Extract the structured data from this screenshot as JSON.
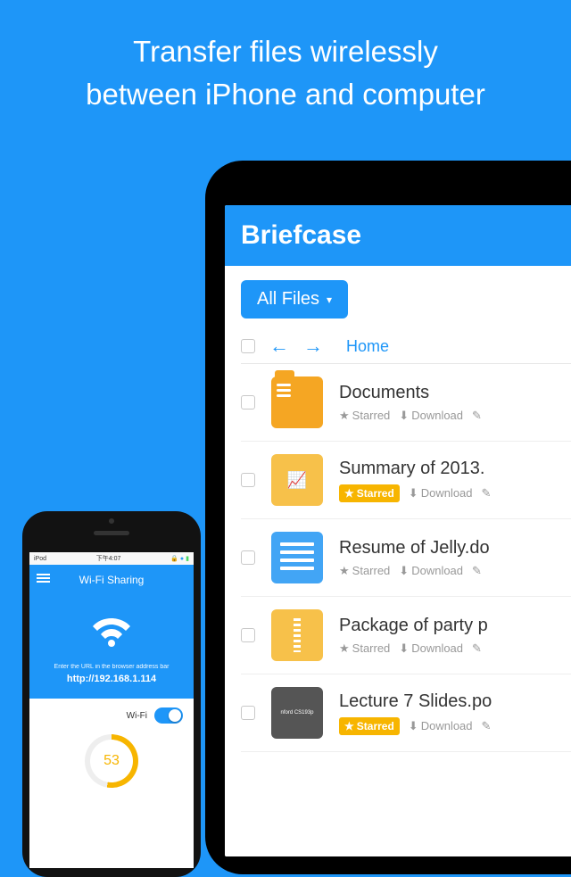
{
  "marketing": {
    "headline_line1": "Transfer files wirelessly",
    "headline_line2": "between iPhone and computer"
  },
  "tablet": {
    "app_title": "Briefcase",
    "dropdown_label": "All Files",
    "breadcrumb": "Home",
    "action_starred": "Starred",
    "action_download": "Download",
    "files": [
      {
        "name": "Documents",
        "starred": false
      },
      {
        "name": "Summary of 2013.",
        "starred": true
      },
      {
        "name": "Resume of Jelly.do",
        "starred": false
      },
      {
        "name": "Package of party p",
        "starred": false
      },
      {
        "name": "Lecture 7 Slides.po",
        "starred": true
      }
    ]
  },
  "phone": {
    "status": {
      "carrier": "iPod",
      "time": "下午4:07"
    },
    "header_title": "Wi-Fi Sharing",
    "instruction": "Enter the URL in the browser address bar",
    "url": "http://192.168.1.114",
    "wifi_label": "Wi-Fi",
    "progress": "53"
  }
}
